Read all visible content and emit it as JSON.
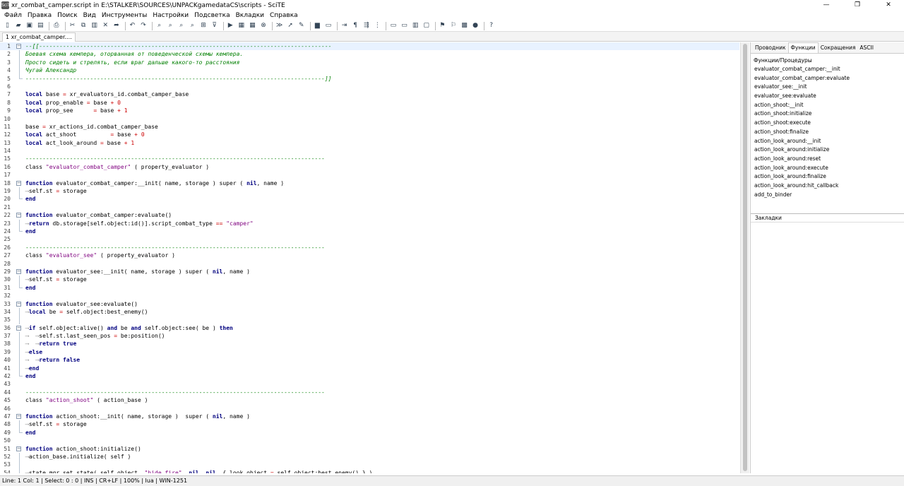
{
  "app": {
    "icon_text": "SciTE",
    "title": "xr_combat_camper.script in E:\\STALKER\\SOURCES\\UNPACKgamedataCS\\scripts - SciTE",
    "window_controls": [
      "—",
      "❐",
      "✕"
    ]
  },
  "menu": [
    "Файл",
    "Правка",
    "Поиск",
    "Вид",
    "Инструменты",
    "Настройки",
    "Подсветка",
    "Вкладки",
    "Справка"
  ],
  "toolbar": {
    "buttons": [
      {
        "icon": "new-file-icon",
        "glyph": "▯"
      },
      {
        "icon": "open-folder-icon",
        "glyph": "▰"
      },
      {
        "icon": "save-icon",
        "glyph": "▣"
      },
      {
        "icon": "save-all-icon",
        "glyph": "▤"
      },
      {
        "sep": true
      },
      {
        "icon": "print-icon",
        "glyph": "⎙"
      },
      {
        "sep": true
      },
      {
        "icon": "cut-icon",
        "glyph": "✂"
      },
      {
        "icon": "copy-icon",
        "glyph": "⧉"
      },
      {
        "icon": "paste-icon",
        "glyph": "▥"
      },
      {
        "icon": "delete-icon",
        "glyph": "✕"
      },
      {
        "icon": "paste-special-icon",
        "glyph": "➦"
      },
      {
        "sep": true
      },
      {
        "icon": "undo-icon",
        "glyph": "↶"
      },
      {
        "icon": "redo-icon",
        "glyph": "↷"
      },
      {
        "sep": true
      },
      {
        "icon": "find-icon",
        "glyph": "⌕"
      },
      {
        "icon": "find-next-icon",
        "glyph": "⌕"
      },
      {
        "icon": "find-in-files-icon",
        "glyph": "⌕"
      },
      {
        "icon": "replace-icon",
        "glyph": "⌕"
      },
      {
        "icon": "go-to-icon",
        "glyph": "⊞"
      },
      {
        "icon": "filter-icon",
        "glyph": "⊽"
      },
      {
        "sep": true
      },
      {
        "icon": "run-icon",
        "glyph": "▶"
      },
      {
        "icon": "build-icon",
        "glyph": "▦"
      },
      {
        "icon": "compile-icon",
        "glyph": "▦"
      },
      {
        "icon": "stop-icon",
        "glyph": "⊗"
      },
      {
        "sep": true
      },
      {
        "icon": "next-message-icon",
        "glyph": "≫"
      },
      {
        "icon": "previous-message-icon",
        "glyph": "➚"
      },
      {
        "icon": "clear-output-icon",
        "glyph": "✎"
      },
      {
        "sep": true
      },
      {
        "icon": "console-icon",
        "glyph": "▆"
      },
      {
        "icon": "output-icon",
        "glyph": "▭"
      },
      {
        "sep": true
      },
      {
        "icon": "wrap-icon",
        "glyph": "⇥"
      },
      {
        "icon": "paragraph-icon",
        "glyph": "¶"
      },
      {
        "icon": "whitespace-icon",
        "glyph": "⇶"
      },
      {
        "icon": "indent-guides-icon",
        "glyph": "⋮"
      },
      {
        "sep": true
      },
      {
        "icon": "split-view-icon",
        "glyph": "▭"
      },
      {
        "icon": "toggle-output-icon",
        "glyph": "▭"
      },
      {
        "icon": "toggle-sidebar-icon",
        "glyph": "▥"
      },
      {
        "icon": "fullscreen-icon",
        "glyph": "▢"
      },
      {
        "sep": true
      },
      {
        "icon": "bookmark-icon",
        "glyph": "⚑"
      },
      {
        "icon": "abbreviation-icon",
        "glyph": "⚐"
      },
      {
        "icon": "macro-icon",
        "glyph": "▩"
      },
      {
        "icon": "record-icon",
        "glyph": "●"
      },
      {
        "sep": true
      },
      {
        "icon": "help-icon",
        "glyph": "?"
      }
    ]
  },
  "tabs": [
    {
      "label": "1 xr_combat_camper...."
    }
  ],
  "editor": {
    "current_line": 1,
    "lines": [
      {
        "n": "1",
        "fold": "start",
        "segs": [
          {
            "t": "--[[--------------------------------------------------------------------------------------",
            "c": "cm"
          }
        ]
      },
      {
        "n": "2",
        "fold": "line",
        "segs": [
          {
            "t": "Боевая схема кемпера, оторванная от поведенческой схемы кемпера.",
            "c": "cm"
          }
        ]
      },
      {
        "n": "3",
        "fold": "line",
        "segs": [
          {
            "t": "Просто сидеть и стрелять, если враг дальше какого-то расстояния",
            "c": "cm"
          }
        ]
      },
      {
        "n": "4",
        "fold": "line",
        "segs": [
          {
            "t": "Чугай Александр",
            "c": "cm"
          }
        ]
      },
      {
        "n": "5",
        "fold": "end",
        "segs": [
          {
            "t": "----------------------------------------------------------------------------------------]]",
            "c": "cm"
          }
        ]
      },
      {
        "n": "6",
        "segs": []
      },
      {
        "n": "7",
        "segs": [
          {
            "t": "local",
            "c": "kw"
          },
          {
            "t": " base "
          },
          {
            "t": "=",
            "c": "op"
          },
          {
            "t": " xr_evaluators_id.combat_camper_base"
          }
        ]
      },
      {
        "n": "8",
        "segs": [
          {
            "t": "local",
            "c": "kw"
          },
          {
            "t": " prop_enable "
          },
          {
            "t": "=",
            "c": "op"
          },
          {
            "t": " base "
          },
          {
            "t": "+",
            "c": "op"
          },
          {
            "t": " "
          },
          {
            "t": "0",
            "c": "num"
          }
        ]
      },
      {
        "n": "9",
        "segs": [
          {
            "t": "local",
            "c": "kw"
          },
          {
            "t": " prop_see      "
          },
          {
            "t": "=",
            "c": "op"
          },
          {
            "t": " base "
          },
          {
            "t": "+",
            "c": "op"
          },
          {
            "t": " "
          },
          {
            "t": "1",
            "c": "num"
          }
        ]
      },
      {
        "n": "10",
        "segs": []
      },
      {
        "n": "11",
        "segs": [
          {
            "t": "base "
          },
          {
            "t": "=",
            "c": "op"
          },
          {
            "t": " xr_actions_id.combat_camper_base"
          }
        ]
      },
      {
        "n": "12",
        "segs": [
          {
            "t": "local",
            "c": "kw"
          },
          {
            "t": " act_shoot          "
          },
          {
            "t": "=",
            "c": "op"
          },
          {
            "t": " base "
          },
          {
            "t": "+",
            "c": "op"
          },
          {
            "t": " "
          },
          {
            "t": "0",
            "c": "num"
          }
        ]
      },
      {
        "n": "13",
        "segs": [
          {
            "t": "local",
            "c": "kw"
          },
          {
            "t": " act_look_around "
          },
          {
            "t": "=",
            "c": "op"
          },
          {
            "t": " base "
          },
          {
            "t": "+",
            "c": "op"
          },
          {
            "t": " "
          },
          {
            "t": "1",
            "c": "num"
          }
        ]
      },
      {
        "n": "14",
        "segs": []
      },
      {
        "n": "15",
        "segs": [
          {
            "t": "----------------------------------------------------------------------------------------",
            "c": "dl"
          }
        ]
      },
      {
        "n": "16",
        "segs": [
          {
            "t": "class "
          },
          {
            "t": "\"evaluator_combat_camper\"",
            "c": "str"
          },
          {
            "t": " ( property_evaluator )"
          }
        ]
      },
      {
        "n": "17",
        "segs": []
      },
      {
        "n": "18",
        "fold": "start",
        "segs": [
          {
            "t": "function",
            "c": "kw"
          },
          {
            "t": " evaluator_combat_camper:__init( name, storage ) super ( "
          },
          {
            "t": "nil",
            "c": "kw"
          },
          {
            "t": ", name )"
          }
        ]
      },
      {
        "n": "19",
        "fold": "line",
        "segs": [
          {
            "t": "⟶",
            "c": "tab"
          },
          {
            "t": "self.st "
          },
          {
            "t": "=",
            "c": "op"
          },
          {
            "t": " storage"
          }
        ]
      },
      {
        "n": "20",
        "fold": "end",
        "segs": [
          {
            "t": "end",
            "c": "kw"
          }
        ]
      },
      {
        "n": "21",
        "segs": []
      },
      {
        "n": "22",
        "fold": "start",
        "segs": [
          {
            "t": "function",
            "c": "kw"
          },
          {
            "t": " evaluator_combat_camper:evaluate()"
          }
        ]
      },
      {
        "n": "23",
        "fold": "line",
        "segs": [
          {
            "t": "⟶",
            "c": "tab"
          },
          {
            "t": "return",
            "c": "kw"
          },
          {
            "t": " db.storage[self.object:id()].script_combat_type "
          },
          {
            "t": "==",
            "c": "op"
          },
          {
            "t": " "
          },
          {
            "t": "\"camper\"",
            "c": "str"
          }
        ]
      },
      {
        "n": "24",
        "fold": "end",
        "segs": [
          {
            "t": "end",
            "c": "kw"
          }
        ]
      },
      {
        "n": "25",
        "segs": []
      },
      {
        "n": "26",
        "segs": [
          {
            "t": "----------------------------------------------------------------------------------------",
            "c": "dl"
          }
        ]
      },
      {
        "n": "27",
        "segs": [
          {
            "t": "class "
          },
          {
            "t": "\"evaluator_see\"",
            "c": "str"
          },
          {
            "t": " ( property_evaluator )"
          }
        ]
      },
      {
        "n": "28",
        "segs": []
      },
      {
        "n": "29",
        "fold": "start",
        "segs": [
          {
            "t": "function",
            "c": "kw"
          },
          {
            "t": " evaluator_see:__init( name, storage ) super ( "
          },
          {
            "t": "nil",
            "c": "kw"
          },
          {
            "t": ", name )"
          }
        ]
      },
      {
        "n": "30",
        "fold": "line",
        "segs": [
          {
            "t": "⟶",
            "c": "tab"
          },
          {
            "t": "self.st "
          },
          {
            "t": "=",
            "c": "op"
          },
          {
            "t": " storage"
          }
        ]
      },
      {
        "n": "31",
        "fold": "end",
        "segs": [
          {
            "t": "end",
            "c": "kw"
          }
        ]
      },
      {
        "n": "32",
        "segs": []
      },
      {
        "n": "33",
        "fold": "start",
        "segs": [
          {
            "t": "function",
            "c": "kw"
          },
          {
            "t": " evaluator_see:evaluate()"
          }
        ]
      },
      {
        "n": "34",
        "fold": "line",
        "segs": [
          {
            "t": "⟶",
            "c": "tab"
          },
          {
            "t": "local",
            "c": "kw"
          },
          {
            "t": " be "
          },
          {
            "t": "=",
            "c": "op"
          },
          {
            "t": " self.object:best_enemy()"
          }
        ]
      },
      {
        "n": "35",
        "fold": "line",
        "segs": []
      },
      {
        "n": "36",
        "fold": "start",
        "segs": [
          {
            "t": "⟶",
            "c": "tab"
          },
          {
            "t": "if",
            "c": "kw"
          },
          {
            "t": " self.object:alive() "
          },
          {
            "t": "and",
            "c": "kw"
          },
          {
            "t": " be "
          },
          {
            "t": "and",
            "c": "kw"
          },
          {
            "t": " self.object:see( be ) "
          },
          {
            "t": "then",
            "c": "kw"
          }
        ]
      },
      {
        "n": "37",
        "fold": "line",
        "segs": [
          {
            "t": "⟶  ⟶",
            "c": "tab"
          },
          {
            "t": "self.st.last_seen_pos "
          },
          {
            "t": "=",
            "c": "op"
          },
          {
            "t": " be:position()"
          }
        ]
      },
      {
        "n": "38",
        "fold": "line",
        "segs": [
          {
            "t": "⟶  ⟶",
            "c": "tab"
          },
          {
            "t": "return",
            "c": "kw"
          },
          {
            "t": " "
          },
          {
            "t": "true",
            "c": "kw"
          }
        ]
      },
      {
        "n": "39",
        "fold": "line",
        "segs": [
          {
            "t": "⟶",
            "c": "tab"
          },
          {
            "t": "else",
            "c": "kw"
          }
        ]
      },
      {
        "n": "40",
        "fold": "line",
        "segs": [
          {
            "t": "⟶  ⟶",
            "c": "tab"
          },
          {
            "t": "return",
            "c": "kw"
          },
          {
            "t": " "
          },
          {
            "t": "false",
            "c": "kw"
          }
        ]
      },
      {
        "n": "41",
        "fold": "line",
        "segs": [
          {
            "t": "⟶",
            "c": "tab"
          },
          {
            "t": "end",
            "c": "kw"
          }
        ]
      },
      {
        "n": "42",
        "fold": "end",
        "segs": [
          {
            "t": "end",
            "c": "kw"
          }
        ]
      },
      {
        "n": "43",
        "segs": []
      },
      {
        "n": "44",
        "segs": [
          {
            "t": "----------------------------------------------------------------------------------------",
            "c": "dl"
          }
        ]
      },
      {
        "n": "45",
        "segs": [
          {
            "t": "class "
          },
          {
            "t": "\"action_shoot\"",
            "c": "str"
          },
          {
            "t": " ( action_base )"
          }
        ]
      },
      {
        "n": "46",
        "segs": []
      },
      {
        "n": "47",
        "fold": "start",
        "segs": [
          {
            "t": "function",
            "c": "kw"
          },
          {
            "t": " action_shoot:__init( name, storage )  super ( "
          },
          {
            "t": "nil",
            "c": "kw"
          },
          {
            "t": ", name )"
          }
        ]
      },
      {
        "n": "48",
        "fold": "line",
        "segs": [
          {
            "t": "⟶",
            "c": "tab"
          },
          {
            "t": "self.st "
          },
          {
            "t": "=",
            "c": "op"
          },
          {
            "t": " storage"
          }
        ]
      },
      {
        "n": "49",
        "fold": "end",
        "segs": [
          {
            "t": "end",
            "c": "kw"
          }
        ]
      },
      {
        "n": "50",
        "segs": []
      },
      {
        "n": "51",
        "fold": "start",
        "segs": [
          {
            "t": "function",
            "c": "kw"
          },
          {
            "t": " action_shoot:initialize()"
          }
        ]
      },
      {
        "n": "52",
        "fold": "line",
        "segs": [
          {
            "t": "⟶",
            "c": "tab"
          },
          {
            "t": "action_base.initialize( self )"
          }
        ]
      },
      {
        "n": "53",
        "fold": "line",
        "segs": []
      },
      {
        "n": "54",
        "fold": "line",
        "segs": [
          {
            "t": "⟶",
            "c": "tab"
          },
          {
            "t": "state_mgr.set_state( self.object, "
          },
          {
            "t": "\"hide_fire\"",
            "c": "str"
          },
          {
            "t": ", "
          },
          {
            "t": "nil",
            "c": "kw"
          },
          {
            "t": ", "
          },
          {
            "t": "nil",
            "c": "kw"
          },
          {
            "t": ", { look_object "
          },
          {
            "t": "=",
            "c": "op"
          },
          {
            "t": " self.object:best_enemy() } )"
          }
        ]
      }
    ]
  },
  "sidebar": {
    "tabs": [
      {
        "label": "Проводник",
        "active": false
      },
      {
        "label": "Функции",
        "active": true
      },
      {
        "label": "Сокращения",
        "active": false
      },
      {
        "label": "ASCII",
        "active": false
      }
    ],
    "functions_header": "Функции/Процедуры",
    "functions": [
      "evaluator_combat_camper:__init",
      "evaluator_combat_camper:evaluate",
      "evaluator_see:__init",
      "evaluator_see:evaluate",
      "action_shoot:__init",
      "action_shoot:initialize",
      "action_shoot:execute",
      "action_shoot:finalize",
      "action_look_around:__init",
      "action_look_around:initialize",
      "action_look_around:reset",
      "action_look_around:execute",
      "action_look_around:finalize",
      "action_look_around:hit_callback",
      "add_to_binder"
    ],
    "bookmarks_label": "Закладки"
  },
  "statusbar": {
    "text": "Line: 1 Col: 1  |  Select: 0 : 0  |  INS  |  CR+LF  |  100%  |  lua  |  WIN-1251"
  }
}
